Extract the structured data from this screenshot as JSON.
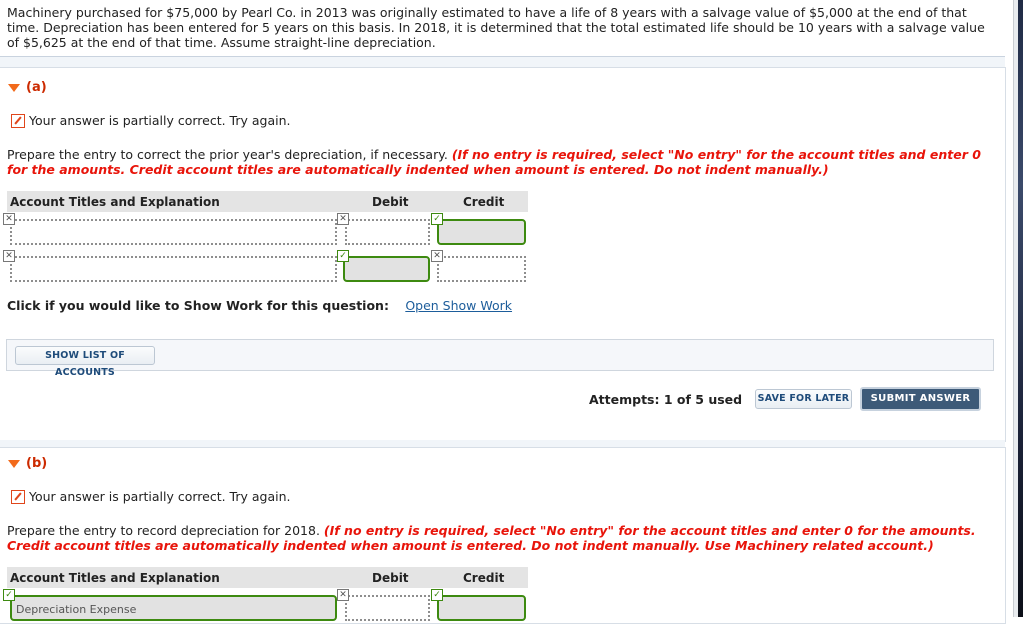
{
  "problem": {
    "text": "Machinery purchased for $75,000 by Pearl Co. in 2013 was originally estimated to have a life of 8 years with a salvage value of $5,000 at the end of that time. Depreciation has been entered for 5 years on this basis. In 2018, it is determined that the total estimated life should be 10 years with a salvage value of $5,625 at the end of that time. Assume straight-line depreciation."
  },
  "colors": {
    "section_title": "#cc2a00",
    "instruction_red": "#e8140a",
    "correct_green": "#3d8a10",
    "submit_bg": "#3d5a78",
    "link": "#1d5d9b"
  },
  "part_a": {
    "label": "(a)",
    "status": "Your answer is partially correct.  Try again.",
    "instruction": "Prepare the entry to correct the prior year's depreciation, if necessary.",
    "instruction_note": "(If no entry is required, select \"No entry\" for the account titles and enter 0 for the amounts. Credit account titles are automatically indented when amount is entered. Do not indent manually.)",
    "table": {
      "headers": [
        "Account Titles and Explanation",
        "Debit",
        "Credit"
      ],
      "rows": [
        {
          "account": "",
          "account_status": "incorrect",
          "debit": "",
          "debit_status": "incorrect",
          "credit": "",
          "credit_status": "correct"
        },
        {
          "account": "",
          "account_status": "incorrect",
          "debit": "",
          "debit_status": "correct",
          "credit": "",
          "credit_status": "incorrect"
        }
      ]
    },
    "show_work_prompt": "Click if you would like to Show Work for this question:",
    "show_work_link": "Open Show Work",
    "show_accounts_button": "SHOW LIST OF ACCOUNTS",
    "attempts": "Attempts: 1 of 5 used",
    "save_button": "SAVE FOR LATER",
    "submit_button": "SUBMIT ANSWER"
  },
  "part_b": {
    "label": "(b)",
    "status": "Your answer is partially correct.  Try again.",
    "instruction": "Prepare the entry to record depreciation for 2018.",
    "instruction_note": "(If no entry is required, select \"No entry\" for the account titles and enter 0 for the amounts. Credit account titles are automatically indented when amount is entered. Do not indent manually. Use Machinery related account.)",
    "table": {
      "headers": [
        "Account Titles and Explanation",
        "Debit",
        "Credit"
      ],
      "rows": [
        {
          "account": "Depreciation Expense",
          "account_status": "correct",
          "debit": "",
          "debit_status": "incorrect",
          "credit": "",
          "credit_status": "correct"
        }
      ]
    }
  }
}
